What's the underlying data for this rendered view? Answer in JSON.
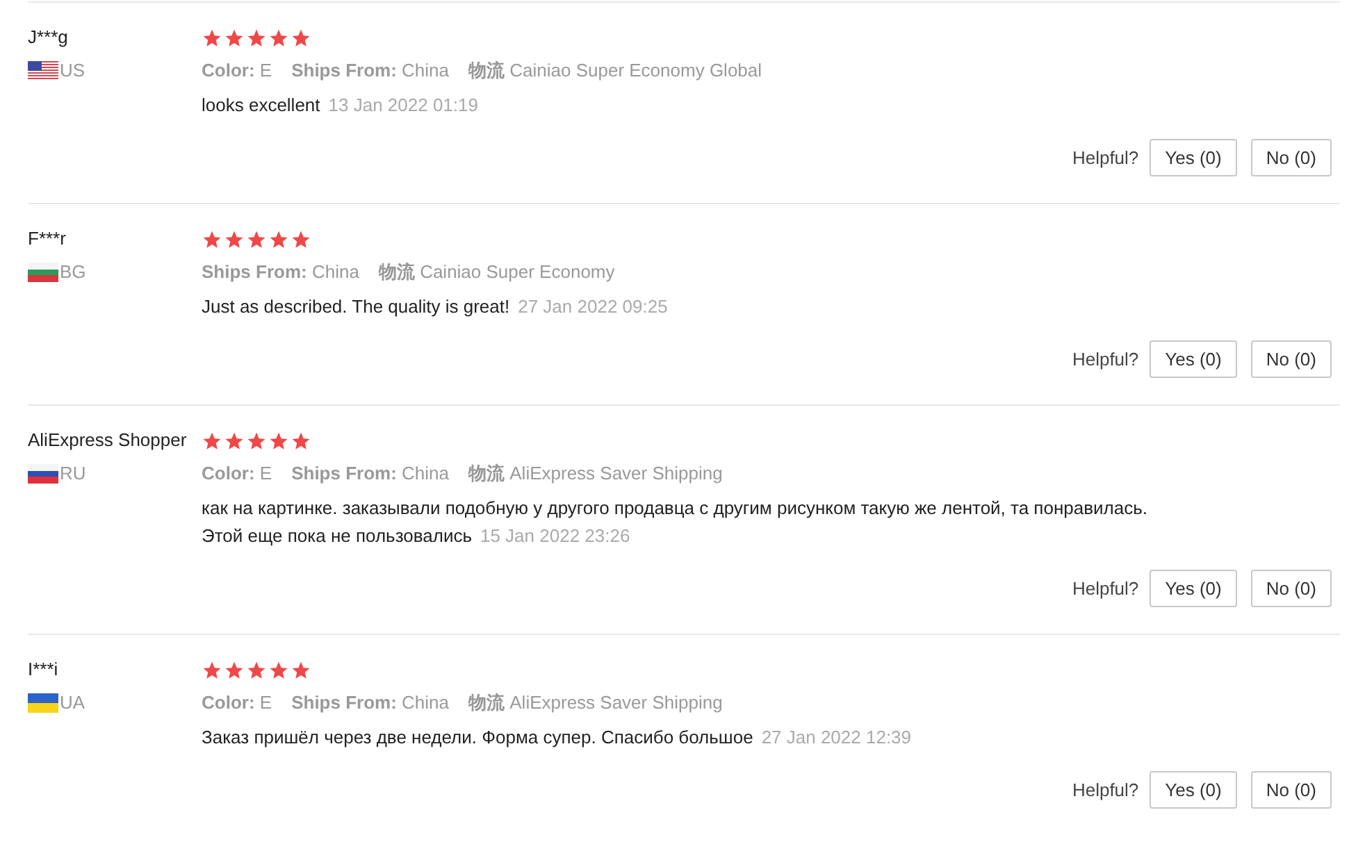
{
  "reviews": [
    {
      "name": "J***g",
      "flag": {
        "kind": "us"
      },
      "country": "US",
      "stars": 5,
      "attributes": [
        {
          "label": "Color:",
          "value": "E"
        },
        {
          "label": "Ships From:",
          "value": "China"
        },
        {
          "label": "物流",
          "value": "Cainiao Super Economy Global"
        }
      ],
      "text": "looks excellent",
      "date": "13 Jan 2022 01:19",
      "helpful_label": "Helpful?",
      "yes": "Yes (0)",
      "no": "No (0)"
    },
    {
      "name": "F***r",
      "flag": {
        "kind": "bg"
      },
      "country": "BG",
      "stars": 5,
      "attributes": [
        {
          "label": "Ships From:",
          "value": "China"
        },
        {
          "label": "物流",
          "value": "Cainiao Super Economy"
        }
      ],
      "text": "Just as described. The quality is great!",
      "date": "27 Jan 2022 09:25",
      "helpful_label": "Helpful?",
      "yes": "Yes (0)",
      "no": "No (0)"
    },
    {
      "name": "AliExpress Shopper",
      "flag": {
        "kind": "ru"
      },
      "country": "RU",
      "stars": 5,
      "attributes": [
        {
          "label": "Color:",
          "value": "E"
        },
        {
          "label": "Ships From:",
          "value": "China"
        },
        {
          "label": "物流",
          "value": "AliExpress Saver Shipping"
        }
      ],
      "text": "как на картинке. заказывали подобную у другого продавца с другим рисунком такую же лентой, та понравилась.\nЭтой еще пока не пользовались",
      "date": "15 Jan 2022 23:26",
      "helpful_label": "Helpful?",
      "yes": "Yes (0)",
      "no": "No (0)"
    },
    {
      "name": "I***i",
      "flag": {
        "kind": "ua"
      },
      "country": "UA",
      "stars": 5,
      "attributes": [
        {
          "label": "Color:",
          "value": "E"
        },
        {
          "label": "Ships From:",
          "value": "China"
        },
        {
          "label": "物流",
          "value": "AliExpress Saver Shipping"
        }
      ],
      "text": "Заказ пришёл через две недели. Форма супер. Спасибо большое",
      "date": "27 Jan 2022 12:39",
      "helpful_label": "Helpful?",
      "yes": "Yes (0)",
      "no": "No (0)"
    }
  ]
}
